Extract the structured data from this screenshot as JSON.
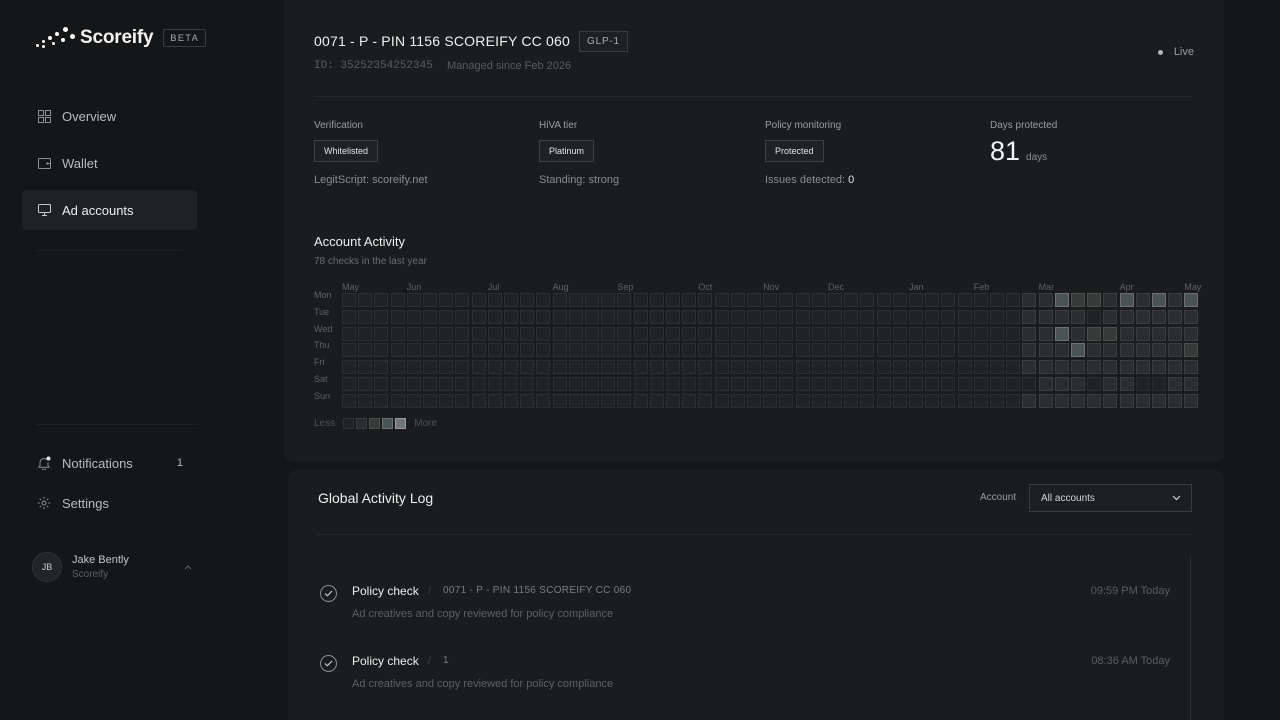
{
  "brand": {
    "name": "Scoreify",
    "beta": "BETA"
  },
  "nav": [
    {
      "label": "Overview",
      "icon": "grid-icon"
    },
    {
      "label": "Wallet",
      "icon": "wallet-icon"
    },
    {
      "label": "Ad accounts",
      "icon": "monitor-icon",
      "active": true
    }
  ],
  "bottom_nav": {
    "notifications": {
      "label": "Notifications",
      "count": "1"
    },
    "settings": {
      "label": "Settings"
    }
  },
  "user": {
    "initials": "JB",
    "name": "Jake Bently",
    "org": "Scoreify"
  },
  "account": {
    "title": "0071 - P - PIN 1156 SCOREIFY CC 060",
    "tag": "GLP-1",
    "id": "ID: 35252354252345",
    "since": "Managed since Feb 2026",
    "status": "Live"
  },
  "stats": {
    "verification": {
      "label": "Verification",
      "value": "Whitelisted",
      "sub": "LegitScript: scoreify.net"
    },
    "hiva": {
      "label": "HiVA tier",
      "value": "Platinum",
      "sub": "Standing: strong"
    },
    "policy": {
      "label": "Policy monitoring",
      "value": "Protected",
      "sub_label": "Issues detected:",
      "sub_value": "0"
    },
    "days": {
      "label": "Days protected",
      "value": "81",
      "unit": "days"
    }
  },
  "activity": {
    "title": "Account Activity",
    "subtitle": "78 checks in the last year",
    "months": [
      "May",
      "Jun",
      "Jul",
      "Aug",
      "Sep",
      "Oct",
      "Nov",
      "Dec",
      "Jan",
      "Feb",
      "Mar",
      "Apr",
      "May"
    ],
    "days": [
      "Mon",
      "Tue",
      "Wed",
      "Thu",
      "Fri",
      "Sat",
      "Sun"
    ],
    "legend_less": "Less",
    "legend_more": "More"
  },
  "log": {
    "title": "Global Activity Log",
    "filter_label": "Account",
    "filter_value": "All accounts",
    "entries": [
      {
        "name": "Policy check",
        "account": "0071 - P - PIN 1156 SCOREIFY CC 060",
        "time": "09:59 PM Today",
        "desc": "Ad creatives and copy reviewed for policy compliance"
      },
      {
        "name": "Policy check",
        "account": "1",
        "time": "08:36 AM Today",
        "desc": "Ad creatives and copy reviewed for policy compliance"
      }
    ]
  },
  "colors": {
    "background": "#141617",
    "card": "#1a1c1d",
    "accent": "#6f7877"
  }
}
